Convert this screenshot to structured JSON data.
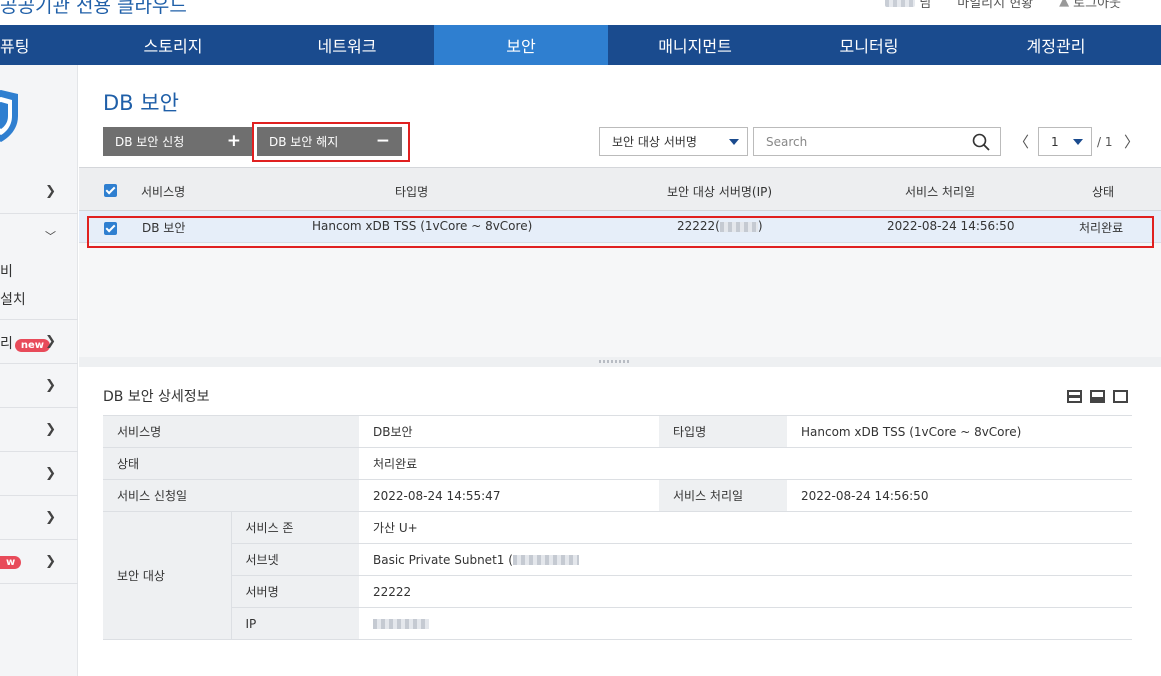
{
  "header": {
    "site_title": "공공기관 전용 클라우드",
    "links": [
      "님",
      "마일리지 현황",
      "로그아웃"
    ]
  },
  "nav": {
    "items": [
      "퓨팅",
      "스토리지",
      "네트워크",
      "보안",
      "매니지먼트",
      "모니터링",
      "계정관리"
    ],
    "active": "보안"
  },
  "sidebar": {
    "sub_items": [
      "비",
      "설치"
    ],
    "new_label_prefix": "리",
    "badge": "new",
    "badge2": "w"
  },
  "page": {
    "title": "DB 보안",
    "apply_button": "DB 보안 신청",
    "apply_symbol": "+",
    "cancel_button": "DB 보안 해지",
    "cancel_symbol": "−",
    "filter_select": "보안 대상 서버명",
    "search_placeholder": "Search",
    "pager": {
      "current": "1",
      "total": "/ 1"
    }
  },
  "grid": {
    "columns": [
      "서비스명",
      "타입명",
      "보안 대상 서버명(IP)",
      "서비스 처리일",
      "상태"
    ],
    "rows": [
      {
        "service": "DB 보안",
        "type": "Hancom xDB TSS (1vCore ~ 8vCore)",
        "server": "22222(",
        "server_end": ")",
        "processed": "2022-08-24 14:56:50",
        "status": "처리완료"
      }
    ]
  },
  "detail": {
    "title": "DB 보안 상세정보",
    "labels": {
      "service_name": "서비스명",
      "type_name": "타입명",
      "status": "상태",
      "requested": "서비스 신청일",
      "processed": "서비스 처리일",
      "target": "보안 대상",
      "zone": "서비스 존",
      "subnet": "서브넷",
      "server_name": "서버명",
      "ip": "IP"
    },
    "values": {
      "service_name": "DB보안",
      "type_name": "Hancom xDB TSS (1vCore ~ 8vCore)",
      "status": "처리완료",
      "requested": "2022-08-24 14:55:47",
      "processed": "2022-08-24 14:56:50",
      "zone": "가산 U+",
      "subnet": "Basic Private Subnet1 (",
      "server_name": "22222"
    }
  },
  "colors": {
    "nav_bg": "#1a4b8e",
    "nav_active": "#2f7fd0",
    "title_blue": "#1f5fa8",
    "highlight": "#e02020",
    "badge": "#e84b5a"
  }
}
